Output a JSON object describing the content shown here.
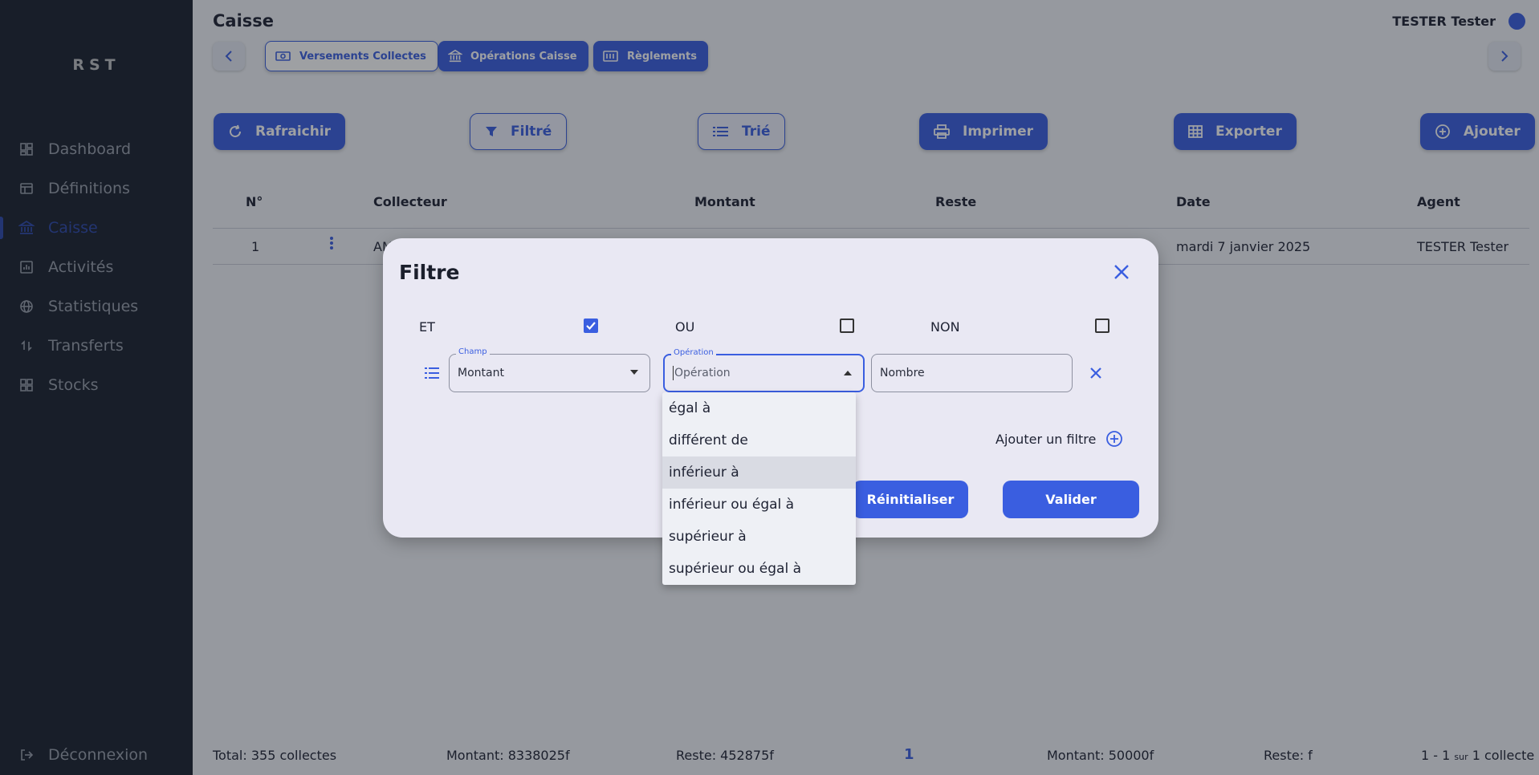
{
  "app": {
    "brand": "RST"
  },
  "sidebar": {
    "items": [
      {
        "label": "Dashboard",
        "icon": "dashboard-icon"
      },
      {
        "label": "Définitions",
        "icon": "table-icon"
      },
      {
        "label": "Caisse",
        "icon": "bank-icon",
        "active": true
      },
      {
        "label": "Activités",
        "icon": "chart-icon"
      },
      {
        "label": "Statistiques",
        "icon": "globe-icon"
      },
      {
        "label": "Transferts",
        "icon": "transfer-icon"
      },
      {
        "label": "Stocks",
        "icon": "grid-icon"
      }
    ],
    "logout": "Déconnexion"
  },
  "header": {
    "title": "Caisse",
    "user": "TESTER Tester"
  },
  "tabs": [
    {
      "label": "Versements Collectes",
      "style": "outline"
    },
    {
      "label": "Opérations Caisse",
      "style": "filled"
    },
    {
      "label": "Règlements",
      "style": "filled"
    }
  ],
  "actions": {
    "refresh": "Rafraichir",
    "filter": "Filtré",
    "sort": "Trié",
    "print": "Imprimer",
    "export": "Exporter",
    "add": "Ajouter"
  },
  "table": {
    "columns": [
      "N°",
      "Collecteur",
      "Montant",
      "Reste",
      "Date",
      "Agent"
    ],
    "rows": [
      {
        "num": "1",
        "collecteur": "AM",
        "date": "mardi 7 janvier 2025",
        "agent": "TESTER Tester"
      }
    ]
  },
  "footer": {
    "total": "Total: 355 collectes",
    "montant_total": "Montant: 8338025f",
    "reste_total": "Reste: 452875f",
    "page": "1",
    "montant_page": "Montant: 50000f",
    "reste_page": "Reste: f",
    "range_a": "1 - 1",
    "range_sur": "sur",
    "range_b": "1 collecte"
  },
  "dialog": {
    "title": "Filtre",
    "logic": [
      {
        "label": "ET",
        "checked": true
      },
      {
        "label": "OU",
        "checked": false
      },
      {
        "label": "NON",
        "checked": false
      }
    ],
    "champ_label": "Champ",
    "champ_value": "Montant",
    "operation_label": "Opération",
    "operation_placeholder": "Opération",
    "value_placeholder": "Nombre",
    "add_filter": "Ajouter un filtre",
    "reset": "Réinitialiser",
    "validate": "Valider"
  },
  "dropdown": {
    "options": [
      "égal à",
      "différent de",
      "inférieur à",
      "inférieur ou égal à",
      "supérieur à",
      "supérieur ou égal à"
    ],
    "highlighted": "inférieur à"
  },
  "colors": {
    "accent": "#3a5ee0",
    "sidebar": "#202838",
    "background": "#f1f3f8"
  }
}
